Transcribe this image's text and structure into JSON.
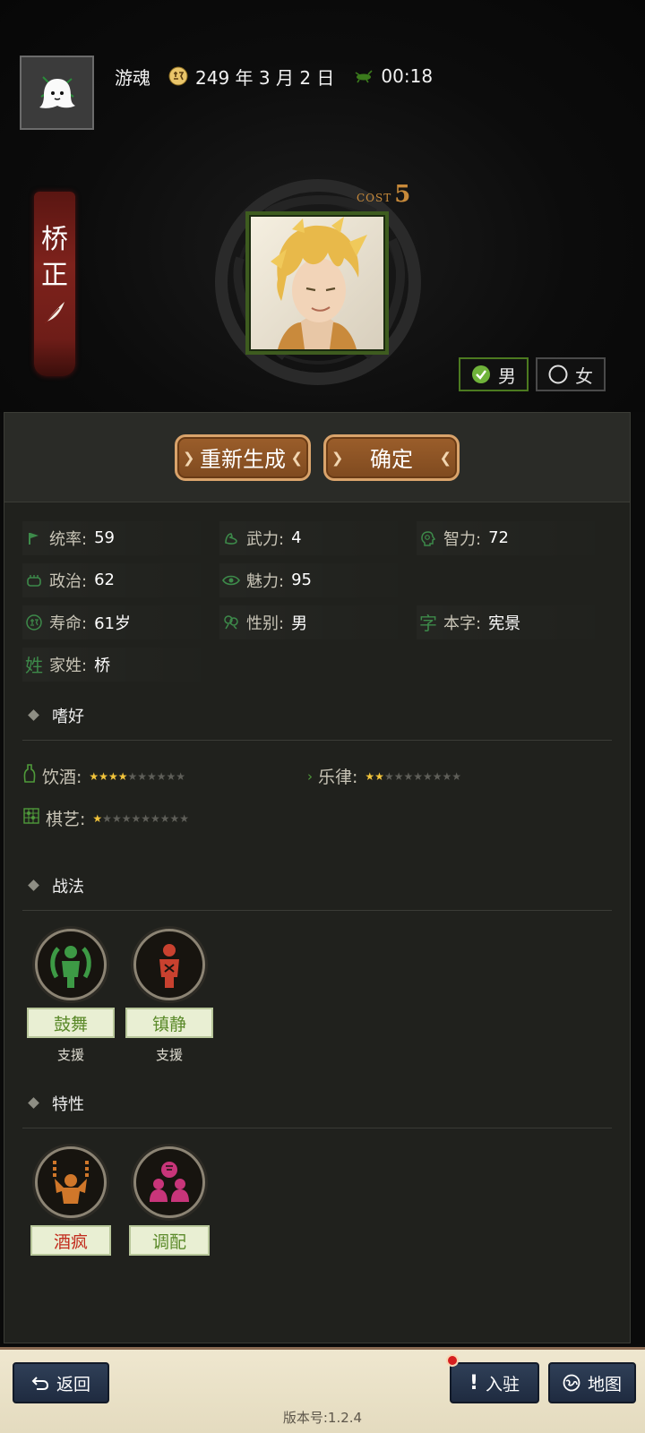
{
  "header": {
    "player_name": "游魂",
    "date": "249 年 3 月 2 日",
    "time": "00:18"
  },
  "character": {
    "name_chars": [
      "桥",
      "正"
    ],
    "cost_label": "COST",
    "cost_value": "5"
  },
  "gender_options": {
    "male": "男",
    "female": "女",
    "selected": "male"
  },
  "actions": {
    "regenerate": "重新生成",
    "confirm": "确定"
  },
  "stats": {
    "tonglv": {
      "label": "统率:",
      "value": "59"
    },
    "wuli": {
      "label": "武力:",
      "value": "4"
    },
    "zhili": {
      "label": "智力:",
      "value": "72"
    },
    "zhengzhi": {
      "label": "政治:",
      "value": "62"
    },
    "meili": {
      "label": "魅力:",
      "value": "95"
    },
    "shouming": {
      "label": "寿命:",
      "value": "61岁"
    },
    "xingbie": {
      "label": "性别:",
      "value": "男"
    },
    "benzi": {
      "label": "本字:",
      "value": "宪景",
      "icon_char": "字"
    },
    "jiaxing": {
      "label": "家姓:",
      "value": "桥",
      "icon_char": "姓"
    }
  },
  "hobbies": {
    "title": "嗜好",
    "items": [
      {
        "label": "饮酒:",
        "stars": 4,
        "max": 10
      },
      {
        "label": "乐律:",
        "stars": 2,
        "max": 10
      },
      {
        "label": "棋艺:",
        "stars": 1,
        "max": 10
      }
    ]
  },
  "tactics": {
    "title": "战法",
    "items": [
      {
        "name": "鼓舞",
        "type": "支援"
      },
      {
        "name": "镇静",
        "type": "支援"
      }
    ]
  },
  "traits": {
    "title": "特性",
    "items": [
      {
        "name": "酒疯"
      },
      {
        "name": "调配"
      }
    ]
  },
  "bottom_nav": {
    "back": "返回",
    "garrison": "入驻",
    "map": "地图"
  },
  "version": "版本号:1.2.4",
  "colors": {
    "accent_green": "#5b8a2a",
    "brown_button": "#8a5325",
    "trait_red": "#c22a1c",
    "star_gold": "#f2c43b"
  }
}
